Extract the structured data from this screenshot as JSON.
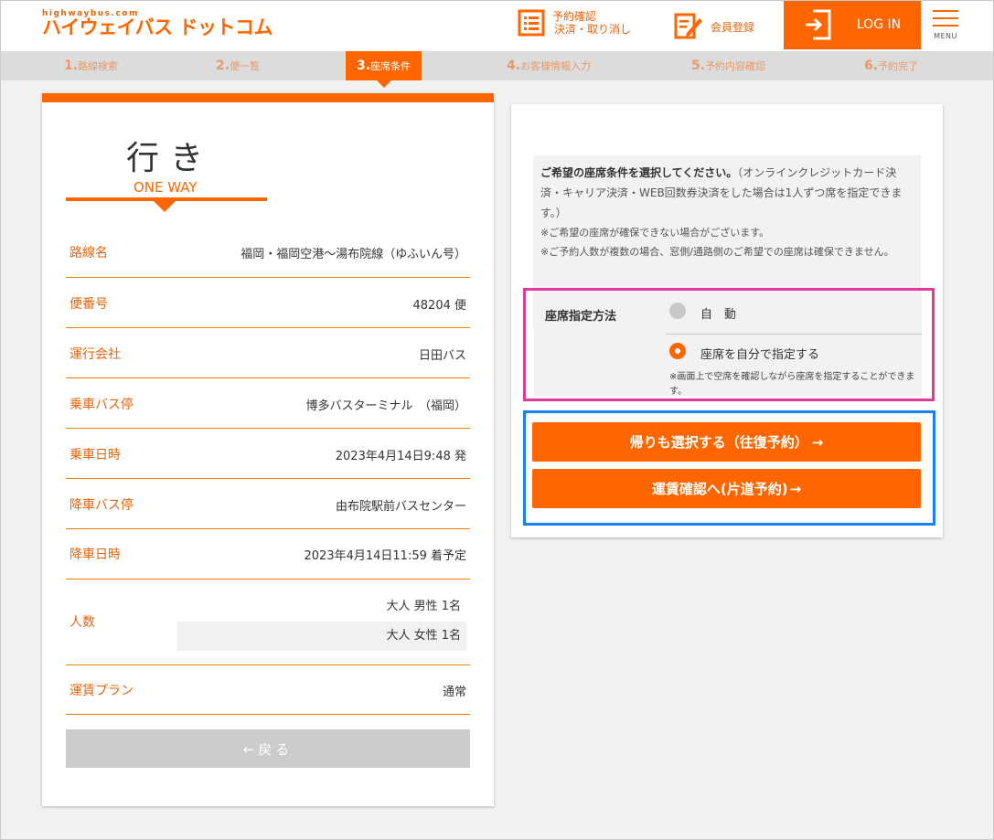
{
  "header": {
    "logo_small": "highwaybus.com",
    "logo_main": "ハイウェイバス ドットコム",
    "reserve_line1": "予約確認",
    "reserve_line2": "決済・取り消し",
    "member_label": "会員登録",
    "login_label": "LOG IN",
    "menu_label": "MENU"
  },
  "steps": [
    {
      "num": "1.",
      "label": "路線検索"
    },
    {
      "num": "2.",
      "label": "便一覧"
    },
    {
      "num": "3.",
      "label": "座席条件"
    },
    {
      "num": "4.",
      "label": "お客様情報入力"
    },
    {
      "num": "5.",
      "label": "予約内容確認"
    },
    {
      "num": "6.",
      "label": "予約完了"
    }
  ],
  "trip": {
    "title": "行き",
    "subtitle": "ONE WAY",
    "rows": [
      {
        "label": "路線名",
        "value": "福岡・福岡空港〜湯布院線（ゆふいん号）"
      },
      {
        "label": "便番号",
        "value": "48204 便"
      },
      {
        "label": "運行会社",
        "value": "日田バス"
      },
      {
        "label": "乗車バス停",
        "value": "博多バスターミナル　（福岡）"
      },
      {
        "label": "乗車日時",
        "value": "2023年4月14日9:48 発"
      },
      {
        "label": "降車バス停",
        "value": "由布院駅前バスセンター"
      },
      {
        "label": "降車日時",
        "value": "2023年4月14日11:59 着予定"
      }
    ],
    "passengers_label": "人数",
    "passengers": [
      "大人 男性 1名",
      "大人 女性 1名"
    ],
    "fare_plan_label": "運賃プラン",
    "fare_plan_value": "通常",
    "back_label": "←戻る"
  },
  "seat": {
    "notice_lead": "ご希望の座席条件を選択してください。",
    "notice_text": "（オンラインクレジットカード決済・キャリア決済・WEB回数券決済をした場合は1人ずつ席を指定できます。）",
    "notice_1": "※ご希望の座席が確保できない場合がございます。",
    "notice_2": "※ご予約人数が複数の場合、窓側/通路側のご希望での座席は確保できません。",
    "method_label": "座席指定方法",
    "option_auto": "自　動",
    "option_manual": "座席を自分で指定する",
    "manual_note": "※画面上で空席を確認しながら座席を指定することができます。",
    "selected": "manual"
  },
  "actions": {
    "round_trip": "帰りも選択する（往復予約）",
    "one_way": "運賃確認へ(片道予約)"
  },
  "colors": {
    "accent": "#ff6600",
    "highlight_pink": "#e3399a",
    "highlight_blue": "#1a7ff0"
  }
}
